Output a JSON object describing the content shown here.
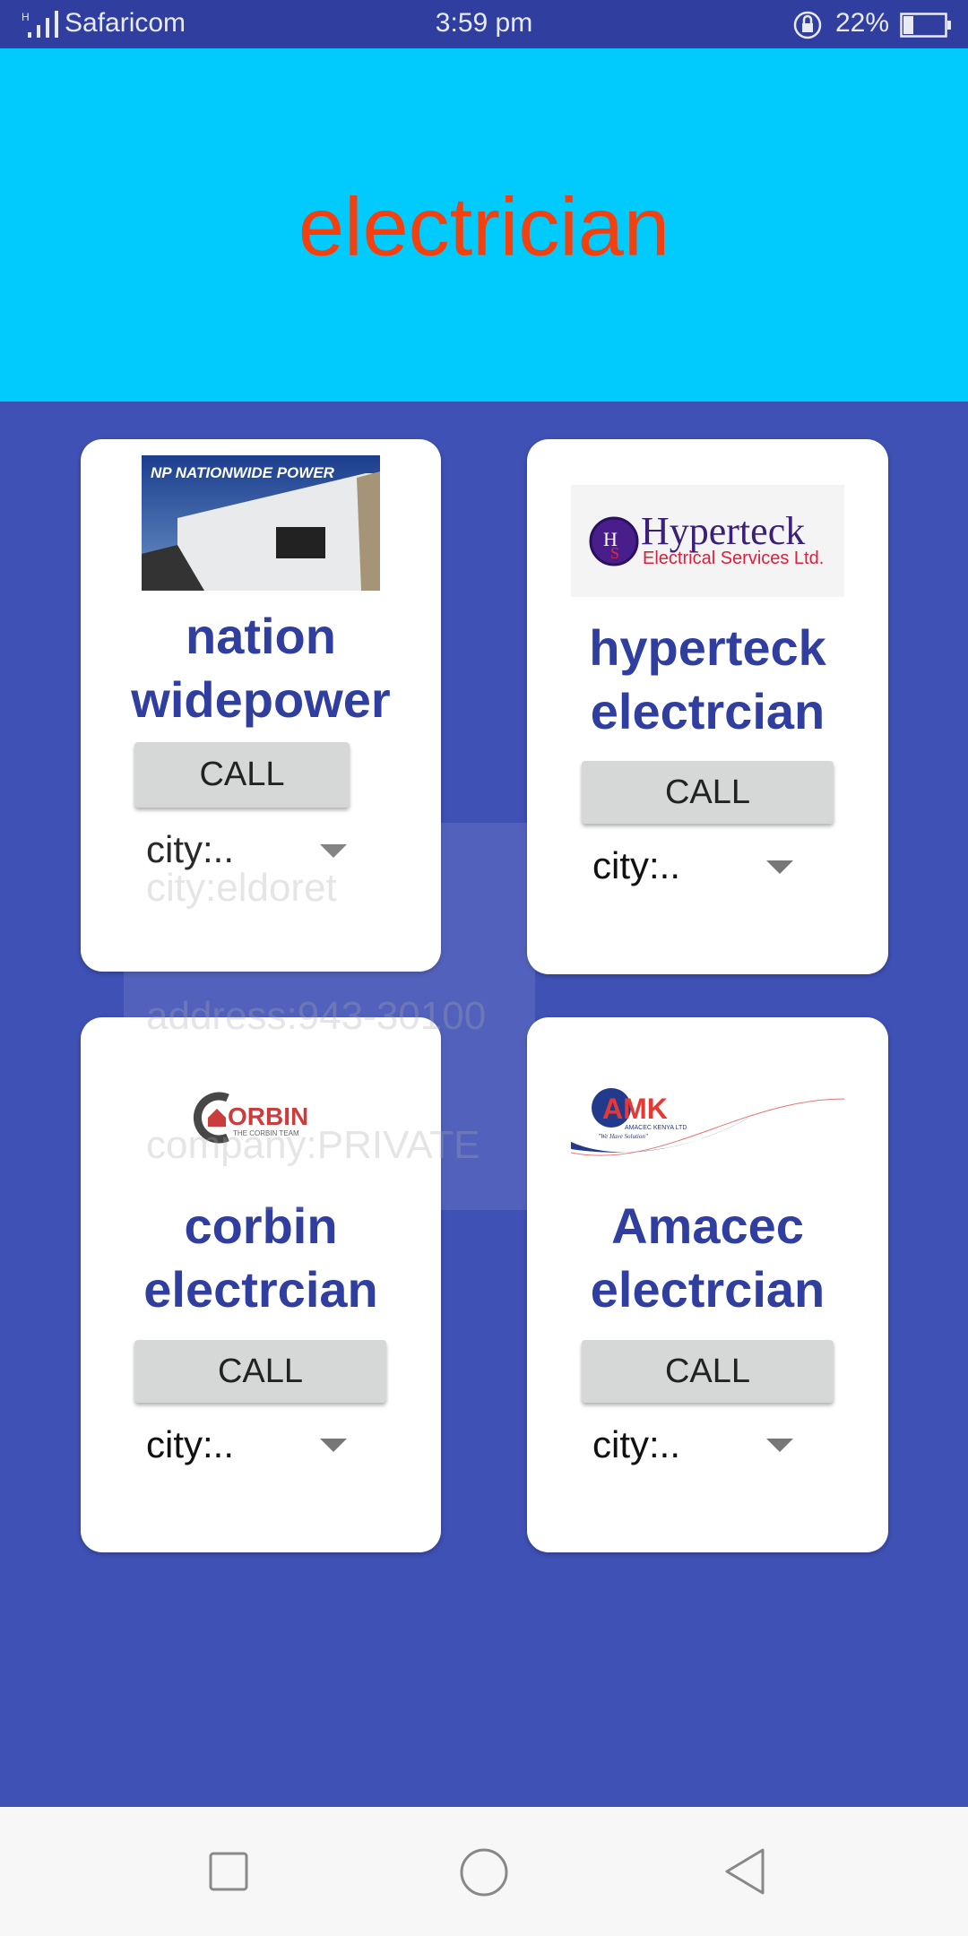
{
  "status_bar": {
    "carrier": "Safaricom",
    "network": "H",
    "time": "3:59 pm",
    "battery": "22%",
    "battery_level": 0.22
  },
  "header": {
    "title": "electrician"
  },
  "cards": [
    {
      "logo_text": "NATIONWIDE POWER",
      "title_line1": "nation",
      "title_line2": "widepower",
      "call_label": "CALL",
      "spinner_value": "city:.."
    },
    {
      "logo_text": "Hyperteck",
      "logo_subtext": "Electrical Services Ltd.",
      "title_line1": "hyperteck",
      "title_line2": "electrcian",
      "call_label": "CALL",
      "spinner_value": "city:.."
    },
    {
      "logo_text": "CORBIN",
      "logo_subtext": "THE CORBIN TEAM",
      "title_line1": "corbin",
      "title_line2": "electrcian",
      "call_label": "CALL",
      "spinner_value": "city:.."
    },
    {
      "logo_text": "AMK",
      "logo_subtext": "AMACEC KENYA LTD",
      "logo_tagline": "We Have Solution",
      "title_line1": "Amacec",
      "title_line2": "electrcian",
      "call_label": "CALL",
      "spinner_value": "city:.."
    }
  ],
  "dropdown": {
    "options": [
      "city:eldoret",
      "address:943-30100",
      "company:PRIVATE"
    ]
  },
  "colors": {
    "header": "#00CBFC",
    "title": "#F4400E",
    "body": "#3F51B5",
    "accent": "#303F9F"
  }
}
